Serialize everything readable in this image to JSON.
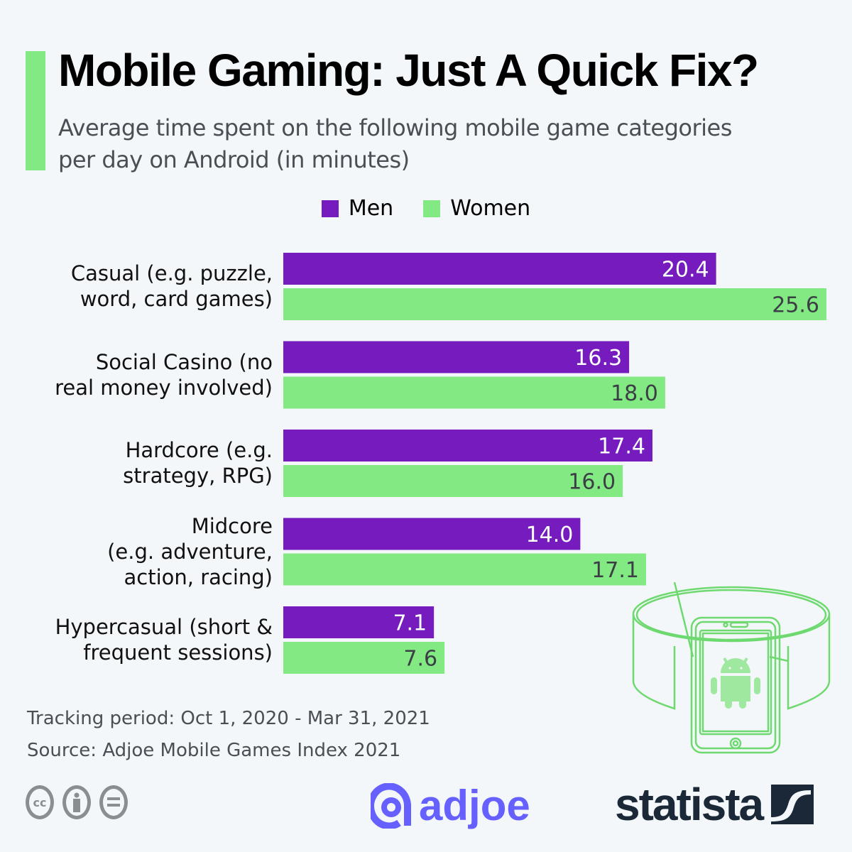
{
  "header": {
    "title": "Mobile Gaming: Just A Quick Fix?",
    "subtitle": "Average time spent on the following mobile game categories per day on Android (in minutes)"
  },
  "colors": {
    "men": "#761cbf",
    "women": "#82e983",
    "accent": "#82e983",
    "men_label": "#ffffff",
    "women_label": "#3b3f45"
  },
  "chart_data": {
    "type": "bar",
    "orientation": "horizontal",
    "title": "Mobile Gaming: Just A Quick Fix?",
    "subtitle": "Average time spent on the following mobile game categories per day on Android (in minutes)",
    "xlabel": "",
    "ylabel": "",
    "xlim": [
      0,
      25.6
    ],
    "grid": false,
    "legend_position": "top-center",
    "categories": [
      "Casual (e.g. puzzle, word, card games)",
      "Social Casino (no real money involved)",
      "Hardcore (e.g. strategy, RPG)",
      "Midcore (e.g. adventure, action, racing)",
      "Hypercasual (short & frequent sessions)"
    ],
    "category_lines": [
      [
        "Casual (e.g. puzzle,",
        "word, card games)"
      ],
      [
        "Social Casino (no",
        "real money involved)"
      ],
      [
        "Hardcore (e.g.",
        "strategy, RPG)"
      ],
      [
        "Midcore",
        "(e.g. adventure,",
        "action, racing)"
      ],
      [
        "Hypercasual (short &",
        "frequent sessions)"
      ]
    ],
    "series": [
      {
        "name": "Men",
        "values": [
          20.4,
          16.3,
          17.4,
          14.0,
          7.1
        ],
        "labels": [
          "20.4",
          "16.3",
          "17.4",
          "14.0",
          "7.1"
        ]
      },
      {
        "name": "Women",
        "values": [
          25.6,
          18.0,
          16.0,
          17.1,
          7.6
        ],
        "labels": [
          "25.6",
          "18.0",
          "16.0",
          "17.1",
          "7.6"
        ]
      }
    ]
  },
  "legend": [
    {
      "label": "Men"
    },
    {
      "label": "Women"
    }
  ],
  "footer": {
    "tracking": "Tracking period: Oct 1, 2020 - Mar 31, 2021",
    "source": "Source: Adjoe Mobile Games Index 2021"
  },
  "branding": {
    "partner": "adjoe",
    "publisher": "statista",
    "license_icons": [
      "cc-icon",
      "attribution-icon",
      "no-derivatives-icon"
    ]
  }
}
